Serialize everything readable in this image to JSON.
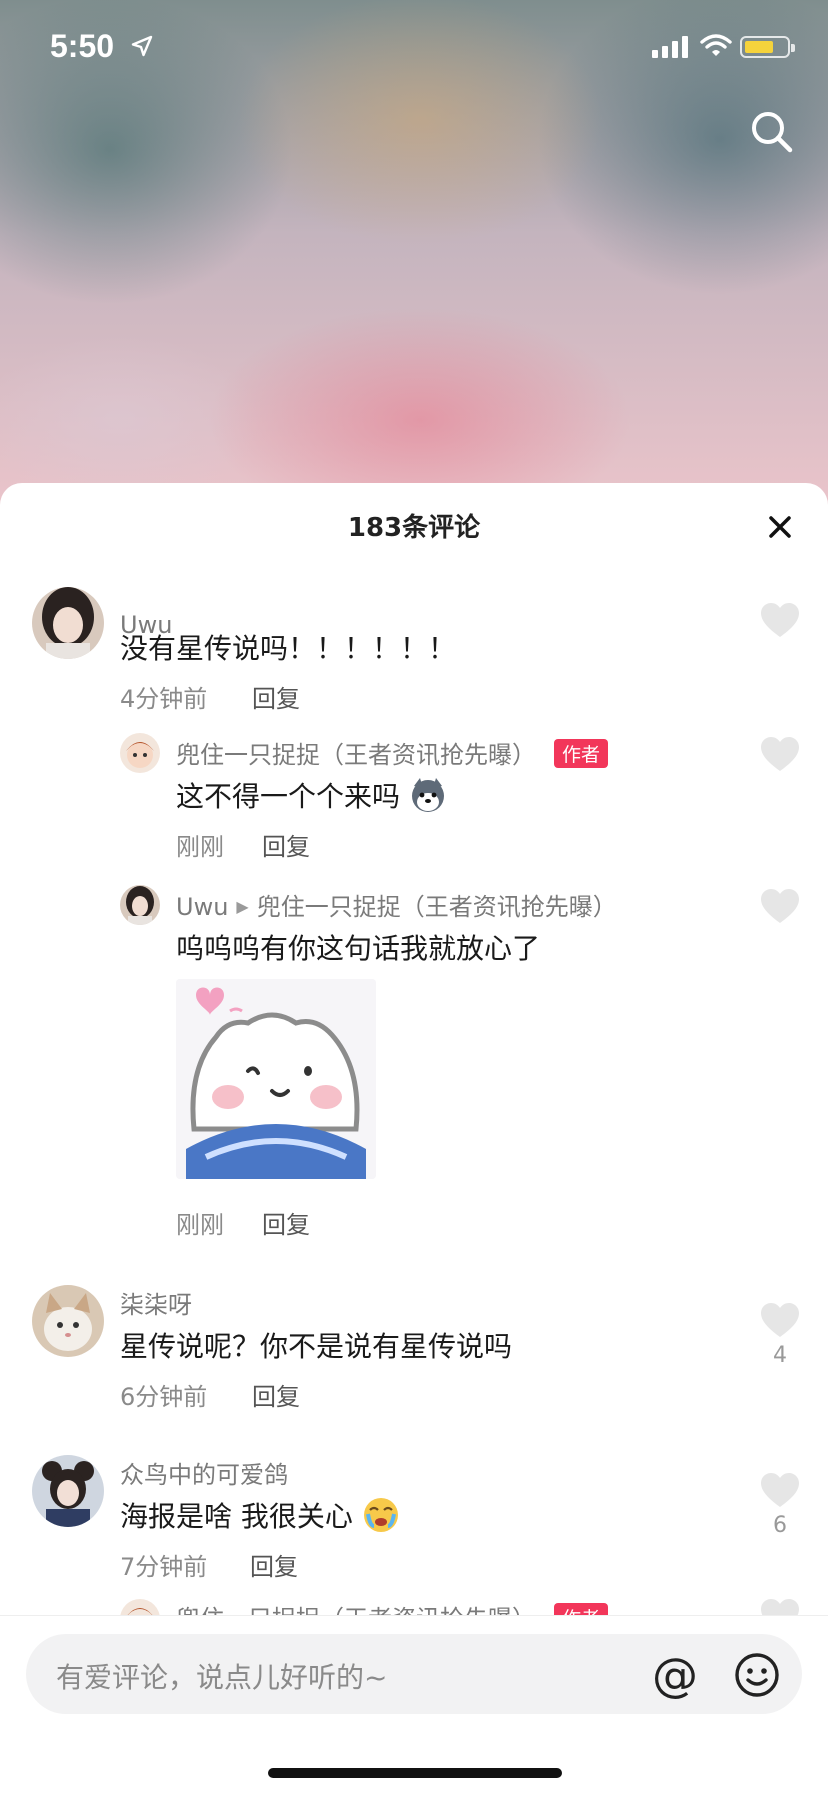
{
  "status_bar": {
    "time": "5:50"
  },
  "sheet": {
    "title": "183条评论"
  },
  "comments": [
    {
      "user": "Uwu",
      "text": "没有星传说吗！！！！！！",
      "time": "4分钟前",
      "reply_label": "回复",
      "replies": [
        {
          "user": "兜住一只捉捉（王者资讯抢先曝）",
          "badge": "作者",
          "text": "这不得一个个来吗",
          "time": "刚刚",
          "reply_label": "回复"
        },
        {
          "user": "Uwu",
          "reply_to": "兜住一只捉捉（王者资讯抢先曝）",
          "text": "呜呜呜有你这句话我就放心了",
          "time": "刚刚",
          "reply_label": "回复"
        }
      ]
    },
    {
      "user": "柒柒呀",
      "text": "星传说呢？你不是说有星传说吗",
      "time": "6分钟前",
      "reply_label": "回复",
      "likes": "4"
    },
    {
      "user": "众鸟中的可爱鸽",
      "text": "海报是啥 我很关心",
      "time": "7分钟前",
      "reply_label": "回复",
      "likes": "6"
    }
  ],
  "partial_reply": {
    "user": "兜住一只捉捉（王者资讯抢先曝）",
    "badge": "作者"
  },
  "input": {
    "placeholder": "有爱评论，说点儿好听的~",
    "at_symbol": "@"
  },
  "icons": [
    "location-arrow-icon",
    "signal-icon",
    "wifi-icon",
    "battery-icon",
    "search-icon",
    "close-icon",
    "heart-icon",
    "emoji-icon"
  ]
}
